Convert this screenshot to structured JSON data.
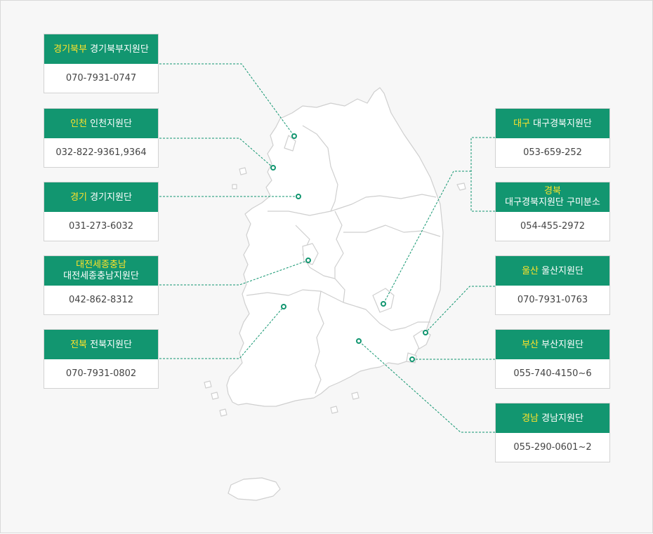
{
  "colors": {
    "header_bg": "#129670",
    "region_text": "#ffe22a",
    "line": "#129670",
    "map_fill": "#ffffff",
    "map_stroke": "#cfcfcf"
  },
  "offices": [
    {
      "id": "gyeonggi-north",
      "region": "경기북부",
      "office": "경기북부지원단",
      "phone": "070-7931-0747"
    },
    {
      "id": "incheon",
      "region": "인천",
      "office": "인천지원단",
      "phone": "032-822-9361,9364"
    },
    {
      "id": "gyeonggi",
      "region": "경기",
      "office": "경기지원단",
      "phone": "031-273-6032"
    },
    {
      "id": "daejeon",
      "region": "대전세종충남",
      "office": "대전세종충남지원단",
      "phone": "042-862-8312"
    },
    {
      "id": "jeonbuk",
      "region": "전북",
      "office": "전북지원단",
      "phone": "070-7931-0802"
    },
    {
      "id": "daegu",
      "region": "대구",
      "office": "대구경북지원단",
      "phone": "053-659-252"
    },
    {
      "id": "gyeongbuk",
      "region": "경북",
      "office": "대구경북지원단 구미분소",
      "phone": "054-455-2972"
    },
    {
      "id": "ulsan",
      "region": "울산",
      "office": "울산지원단",
      "phone": "070-7931-0763"
    },
    {
      "id": "busan",
      "region": "부산",
      "office": "부산지원단",
      "phone": "055-740-4150~6"
    },
    {
      "id": "gyeongnam",
      "region": "경남",
      "office": "경남지원단",
      "phone": "055-290-0601~2"
    }
  ]
}
